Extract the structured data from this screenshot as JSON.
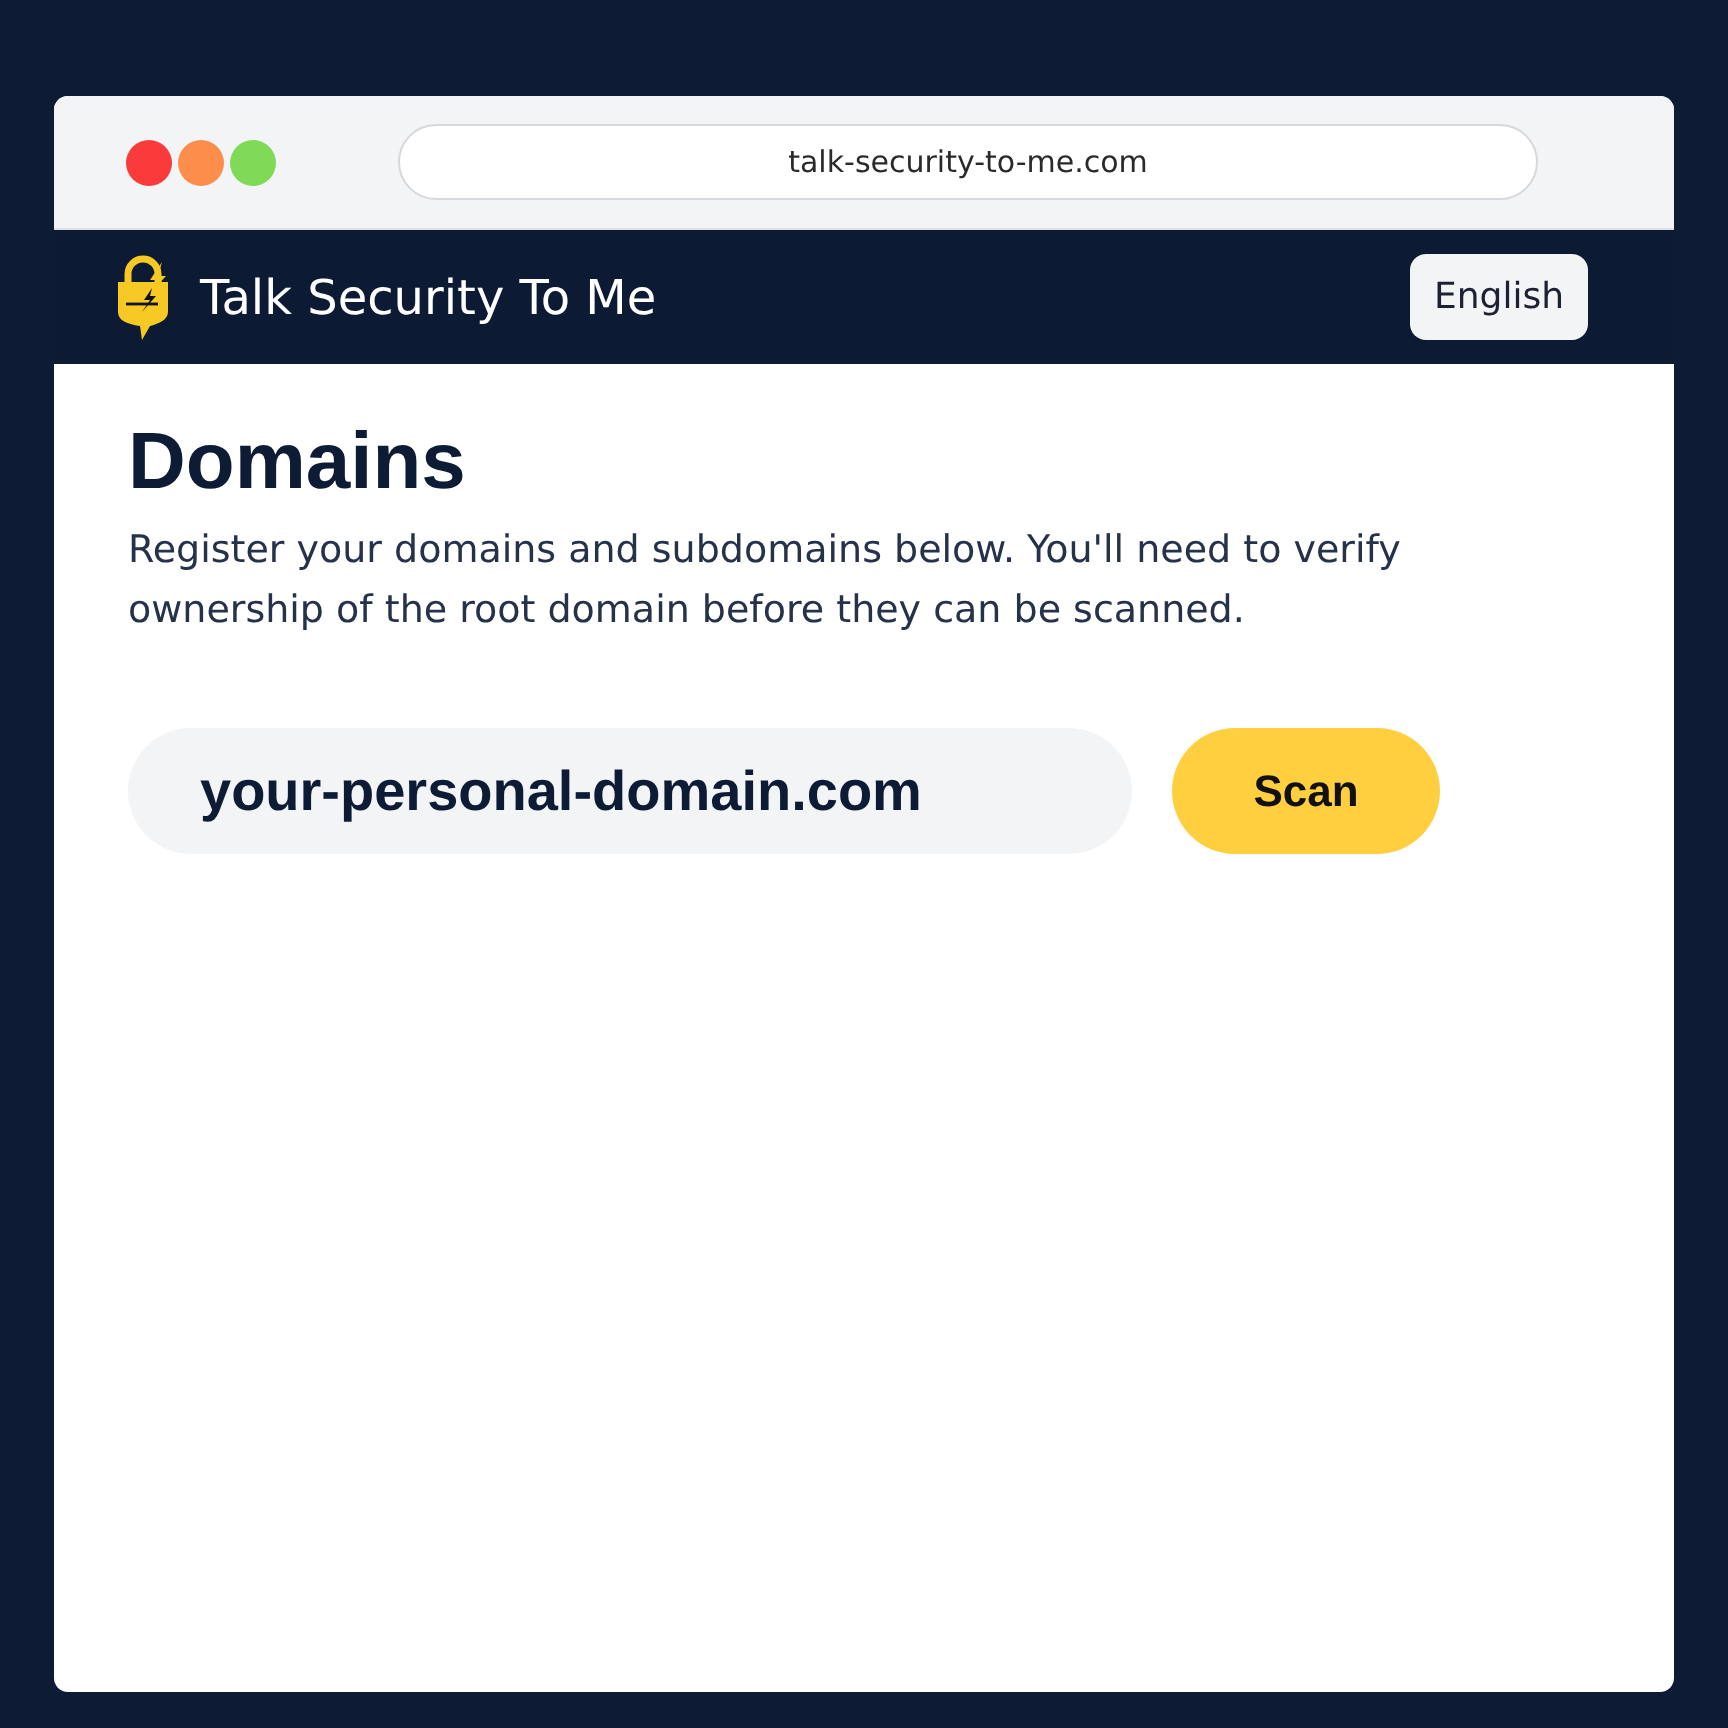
{
  "browser": {
    "window_controls": [
      {
        "color": "#fb3a3a"
      },
      {
        "color": "#fd8d4b"
      },
      {
        "color": "#80d957"
      }
    ],
    "url": "talk-security-to-me.com"
  },
  "navbar": {
    "brand": "Talk Security To Me",
    "language_button": "English"
  },
  "content": {
    "title": "Domains",
    "description": "Register your domains and subdomains below. You'll need to verify ownership of the root domain before they can be scanned.",
    "domain_input": {
      "value": "your-personal-domain.com"
    },
    "scan_button": "Scan"
  }
}
